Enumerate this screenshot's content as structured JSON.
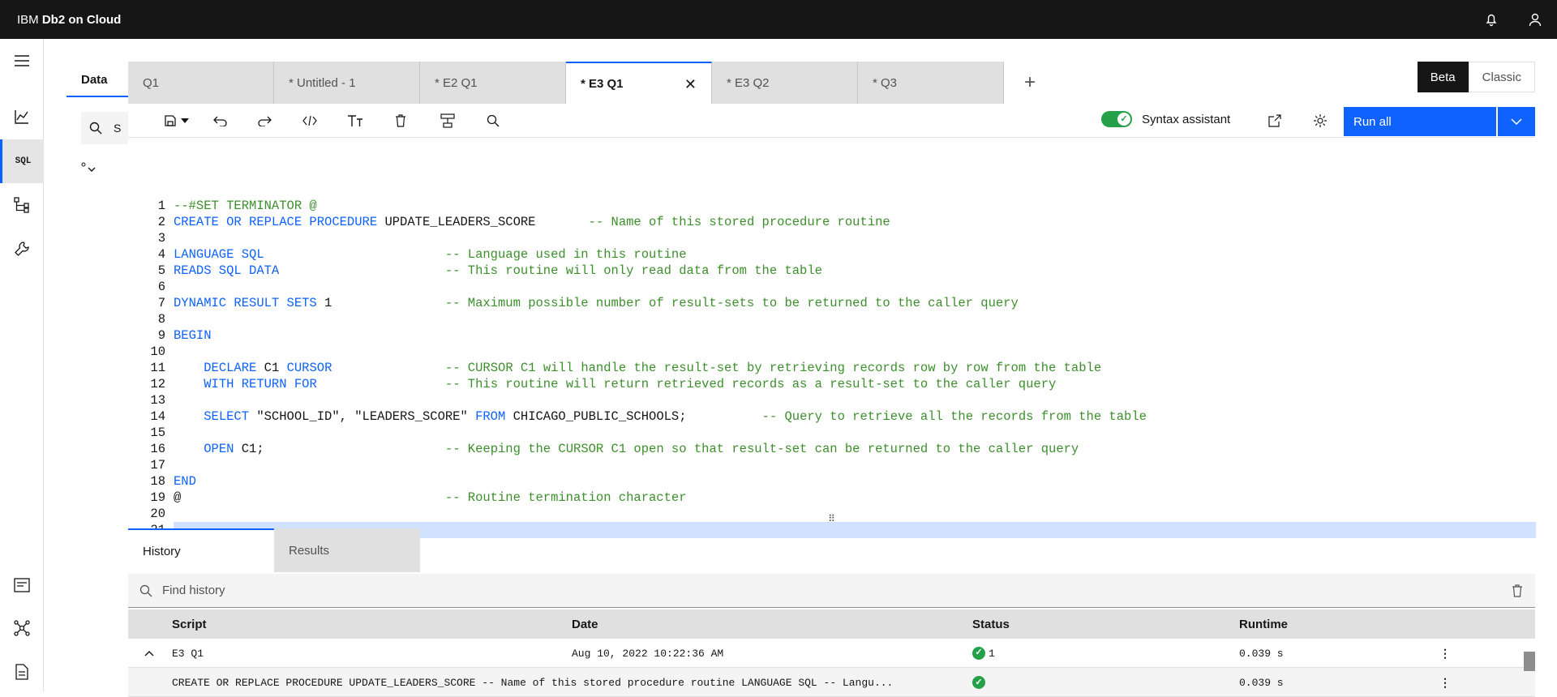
{
  "topbar": {
    "brand_prefix": "IBM ",
    "brand_product": "Db2 on Cloud"
  },
  "sidenav": {
    "sql_label": "SQL"
  },
  "left_panel": {
    "tab_label": "Data",
    "search_text": "S"
  },
  "tabs": [
    {
      "label": "Q1",
      "active": false
    },
    {
      "label": "* Untitled - 1",
      "active": false
    },
    {
      "label": "* E2 Q1",
      "active": false
    },
    {
      "label": "* E3 Q1",
      "active": true
    },
    {
      "label": "* E3 Q2",
      "active": false
    },
    {
      "label": "* Q3",
      "active": false
    }
  ],
  "mode_toggle": {
    "beta": "Beta",
    "classic": "Classic"
  },
  "toolbar": {
    "syntax_assistant": "Syntax assistant",
    "run_all": "Run all"
  },
  "code_lines": [
    "--#SET TERMINATOR @",
    "CREATE OR REPLACE PROCEDURE UPDATE_LEADERS_SCORE       -- Name of this stored procedure routine",
    "",
    "LANGUAGE SQL                        -- Language used in this routine",
    "READS SQL DATA                      -- This routine will only read data from the table",
    "",
    "DYNAMIC RESULT SETS 1               -- Maximum possible number of result-sets to be returned to the caller query",
    "",
    "BEGIN",
    "",
    "    DECLARE C1 CURSOR               -- CURSOR C1 will handle the result-set by retrieving records row by row from the table",
    "    WITH RETURN FOR                 -- This routine will return retrieved records as a result-set to the caller query",
    "",
    "    SELECT \"SCHOOL_ID\", \"LEADERS_SCORE\" FROM CHICAGO_PUBLIC_SCHOOLS;          -- Query to retrieve all the records from the table",
    "",
    "    OPEN C1;                        -- Keeping the CURSOR C1 open so that result-set can be returned to the caller query",
    "",
    "END",
    "@                                   -- Routine termination character",
    "",
    "",
    "",
    ""
  ],
  "bottom_tabs": {
    "history": "History",
    "results": "Results"
  },
  "history": {
    "search_placeholder": "Find history",
    "columns": {
      "script": "Script",
      "date": "Date",
      "status": "Status",
      "runtime": "Runtime"
    },
    "rows": [
      {
        "script": "E3 Q1",
        "date": "Aug 10, 2022 10:22:36 AM",
        "status": "1",
        "runtime": "0.039 s"
      },
      {
        "script": "CREATE OR REPLACE PROCEDURE UPDATE_LEADERS_SCORE -- Name of this stored procedure routine LANGUAGE SQL -- Langu...",
        "date": "",
        "status": "",
        "runtime": "0.039 s"
      }
    ]
  },
  "colors": {
    "accent": "#0f62fe",
    "success": "#24a148",
    "keyword": "#0f62fe",
    "comment": "#3c8f2c"
  }
}
